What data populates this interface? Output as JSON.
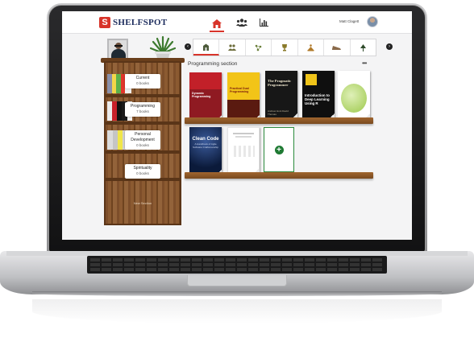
{
  "app": {
    "logo_letter": "S",
    "logo_text": "SHELFSPOT",
    "user_name": "Matt Clagett",
    "accent_color": "#d8342a"
  },
  "nav": {
    "items": [
      {
        "icon": "home-icon",
        "active": true
      },
      {
        "icon": "users-icon",
        "active": false
      },
      {
        "icon": "bar-chart-icon",
        "active": false
      }
    ]
  },
  "bookcase": {
    "shelves": [
      {
        "name": "Current",
        "count": "0 books"
      },
      {
        "name": "Programming",
        "count": "7 books"
      },
      {
        "name": "Personal Development",
        "count": "0 books"
      },
      {
        "name": "Spirituality",
        "count": "0 books"
      }
    ],
    "new_shelf_label": "New Section"
  },
  "categories": [
    {
      "icon": "building-icon",
      "active": true
    },
    {
      "icon": "people-icon",
      "active": false
    },
    {
      "icon": "molecule-icon",
      "active": false
    },
    {
      "icon": "trophy-icon",
      "active": false
    },
    {
      "icon": "meditation-icon",
      "active": false
    },
    {
      "icon": "shoe-icon",
      "active": false
    },
    {
      "icon": "tree-icon",
      "active": false
    }
  ],
  "section": {
    "title": "Programming section",
    "more_label": "•••"
  },
  "books": [
    {
      "title": "Dynamic Programming",
      "author": "",
      "color": "#c8202a"
    },
    {
      "title": "Practical Dual Programming",
      "author": "",
      "color": "#f0c419"
    },
    {
      "title": "The Pragmatic Programmer",
      "author": "Andrew Hunt David Thomas",
      "color": "#1b1b1b"
    },
    {
      "title": "Introduction to Deep Learning Using R",
      "author": "",
      "color": "#0e0e0e"
    },
    {
      "title": "",
      "author": "",
      "color": "#e9f2d9"
    },
    {
      "title": "Clean Code",
      "author": "A Handbook of Agile Software Craftsmanship",
      "color": "#0b1a3a"
    },
    {
      "title": "",
      "author": "",
      "color": "#ffffff"
    }
  ]
}
